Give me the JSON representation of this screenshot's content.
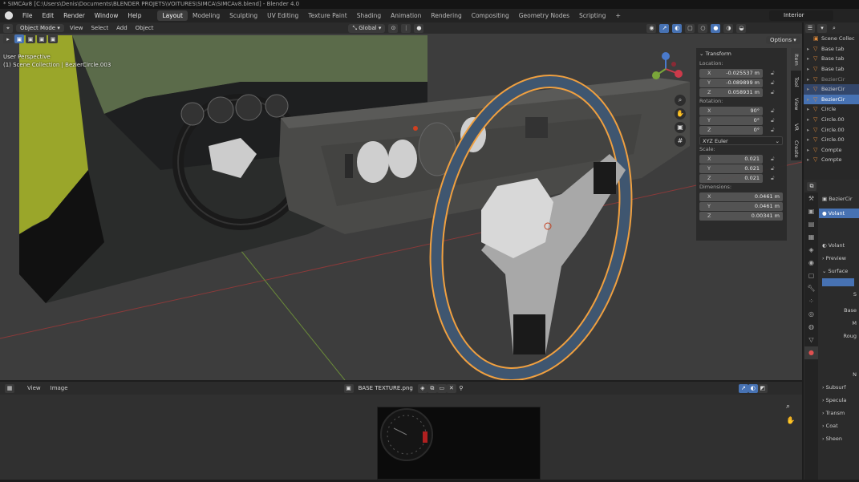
{
  "title_bar": {
    "text": "* SIMCAv8 [C:\\Users\\Denis\\Documents\\BLENDER PROJETS\\VOITURES\\SIMCA\\SIMCAv8.blend] - Blender 4.0"
  },
  "menu": [
    "File",
    "Edit",
    "Render",
    "Window",
    "Help"
  ],
  "workspaces": [
    "Layout",
    "Modeling",
    "Sculpting",
    "UV Editing",
    "Texture Paint",
    "Shading",
    "Animation",
    "Rendering",
    "Compositing",
    "Geometry Nodes",
    "Scripting"
  ],
  "scene_name": "Interior",
  "viewport_header": {
    "mode": "Object Mode",
    "menus": [
      "View",
      "Select",
      "Add",
      "Object"
    ],
    "orientation": "Global"
  },
  "viewport_info": {
    "line1": "User Perspective",
    "line2": "(1) Scene Collection | BezierCircle.003"
  },
  "options_label": "Options",
  "n_panel": {
    "section": "Transform",
    "location_label": "Location:",
    "location": [
      {
        "axis": "X",
        "value": "-0.025537 m"
      },
      {
        "axis": "Y",
        "value": "-0.089899 m"
      },
      {
        "axis": "Z",
        "value": "0.058931 m"
      }
    ],
    "rotation_label": "Rotation:",
    "rotation": [
      {
        "axis": "X",
        "value": "90°"
      },
      {
        "axis": "Y",
        "value": "0°"
      },
      {
        "axis": "Z",
        "value": "0°"
      }
    ],
    "rotation_mode": "XYZ Euler",
    "scale_label": "Scale:",
    "scale": [
      {
        "axis": "X",
        "value": "0.021"
      },
      {
        "axis": "Y",
        "value": "0.021"
      },
      {
        "axis": "Z",
        "value": "0.021"
      }
    ],
    "dimensions_label": "Dimensions:",
    "dimensions": [
      {
        "axis": "X",
        "value": "0.0461 m"
      },
      {
        "axis": "Y",
        "value": "0.0461 m"
      },
      {
        "axis": "Z",
        "value": "0.00341 m"
      }
    ],
    "tabs": [
      "Item",
      "Tool",
      "View",
      "VR",
      "Create"
    ]
  },
  "image_editor": {
    "menus": [
      "View",
      "Image"
    ],
    "image_name": "BASE TEXTURE.png"
  },
  "outliner": {
    "items": [
      {
        "label": "Scene Collec",
        "state": "normal"
      },
      {
        "label": "Base tab",
        "state": "normal"
      },
      {
        "label": "Base tab",
        "state": "normal"
      },
      {
        "label": "Base tab",
        "state": "normal"
      },
      {
        "label": "BezierCir",
        "state": "dim"
      },
      {
        "label": "BezierCir",
        "state": "sel"
      },
      {
        "label": "BezierCir",
        "state": "active"
      },
      {
        "label": "Circle",
        "state": "normal"
      },
      {
        "label": "Circle.00",
        "state": "normal"
      },
      {
        "label": "Circle.00",
        "state": "normal"
      },
      {
        "label": "Circle.00",
        "state": "normal"
      },
      {
        "label": "Compte",
        "state": "normal"
      },
      {
        "label": "Compte",
        "state": "normal"
      }
    ]
  },
  "properties": {
    "object_name": "BezierCir",
    "material_slot": "Volant",
    "material_name": "Volant",
    "rows": [
      "Preview",
      "Surface",
      "S",
      "Base",
      "M",
      "Roug",
      "N",
      "Subsurf",
      "Specula",
      "Transm",
      "Coat",
      "Sheen"
    ]
  },
  "colors": {
    "accent": "#4772b3",
    "orange_select": "#f0a040",
    "dash": "#4a4a48",
    "car_yellow": "#9aa62a"
  }
}
